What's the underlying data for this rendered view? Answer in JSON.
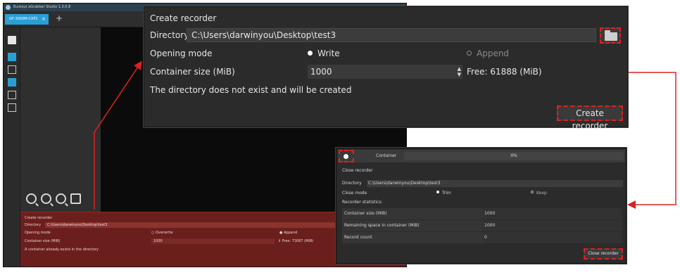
{
  "app": {
    "title": "Euresys eGrabber Studio 1.3.0.8",
    "tab_label": "GF-3000M-CXP2",
    "new_tab_label": "+",
    "bottom_panel": {
      "title": "Create recorder",
      "directory_label": "Directory",
      "directory_value": "C:\\Users\\darwinyou\\Desktop\\test3",
      "opening_mode_label": "Opening mode",
      "overwrite_label": "Overwrite",
      "append_label": "Append",
      "container_size_label": "Container size (MiB)",
      "container_size_value": "1000",
      "free_label": "Free: 73087 (MiB)",
      "message": "A container already exists in the directory"
    }
  },
  "create_recorder": {
    "title": "Create recorder",
    "directory_label": "Directory",
    "directory_value": "C:\\Users\\darwinyou\\Desktop\\test3",
    "folder_icon": "folder-open-icon",
    "opening_mode_label": "Opening mode",
    "write_label": "Write",
    "append_label": "Append",
    "selected_mode": "Write",
    "container_size_label": "Container size (MiB)",
    "container_size_value": "1000",
    "free_label": "Free: 61888 (MiB)",
    "message": "The directory does not exist and will be created",
    "create_button_label": "Create recorder"
  },
  "close_recorder": {
    "container_label": "Container",
    "progress_text": "0%",
    "progress_value": 0,
    "title": "Close recorder",
    "directory_label": "Directory",
    "directory_value": "C:\\Users\\darwinyou\\Desktop\\test3",
    "close_mode_label": "Close mode",
    "trim_label": "Trim",
    "keep_label": "Keep",
    "selected_mode": "Trim",
    "statistics_label": "Recorder statistics:",
    "stats": [
      {
        "key": "Container size (MiB)",
        "value": "1000"
      },
      {
        "key": "Remaining space in container (MiB)",
        "value": "1000"
      },
      {
        "key": "Record count",
        "value": "0"
      }
    ],
    "close_button_label": "Close recorder"
  },
  "colors": {
    "highlight": "#e02020",
    "accent": "#2a9fd6",
    "panel_bg": "#2b2b2b"
  }
}
